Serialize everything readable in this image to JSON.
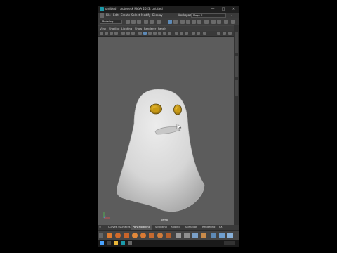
{
  "window": {
    "title": "untitled* - Autodesk MAYA 2023: untitled",
    "controls": {
      "minimize": "—",
      "maximize": "□",
      "close": "✕"
    }
  },
  "menubar": {
    "items": [
      "File",
      "Edit",
      "Create",
      "Select",
      "Modify",
      "Display"
    ],
    "workspace_label": "Workspace:",
    "workspace_value": "Maya C"
  },
  "statusline": {
    "mode": "Modeling"
  },
  "panel_menu": {
    "items": [
      "View",
      "Shading",
      "Lighting",
      "Show",
      "Renderer",
      "Panels"
    ]
  },
  "viewport": {
    "camera_label": "persp"
  },
  "shelf": {
    "tabs": [
      "Curves / Surfaces",
      "Poly Modeling",
      "Sculpting",
      "Rigging",
      "Animation",
      "Rendering",
      "FX"
    ],
    "active_tab": "Poly Modeling"
  },
  "colors": {
    "accent": "#5d8ab7",
    "ghost_body": "#d8d8d8",
    "ghost_eyes": "#e6b320",
    "viewport_bg": "#5c5c5c"
  }
}
